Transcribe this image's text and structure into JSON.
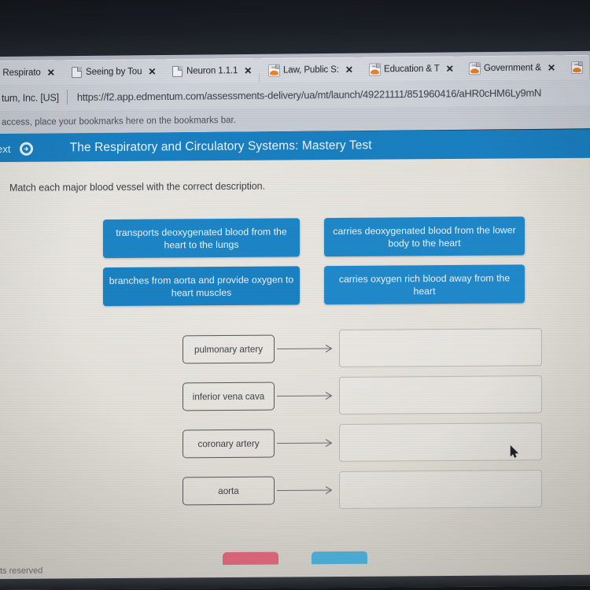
{
  "browser": {
    "tabs": [
      {
        "title": "e Respirato",
        "favicon": "page-icon",
        "partial": true
      },
      {
        "title": "Seeing by Tou",
        "favicon": "page-icon",
        "partial": false
      },
      {
        "title": "Neuron 1.1.1",
        "favicon": "page-icon",
        "partial": false
      },
      {
        "title": "Law, Public S:",
        "favicon": "edmentum-icon",
        "partial": false
      },
      {
        "title": "Education & T",
        "favicon": "edmentum-icon",
        "partial": false
      },
      {
        "title": "Government &",
        "favicon": "edmentum-icon",
        "partial": false
      },
      {
        "title": "",
        "favicon": "edmentum-icon",
        "partial": false
      }
    ],
    "tab_close_label": "✕",
    "site_identity": "tum, Inc. [US]",
    "url": "https://f2.app.edmentum.com/assessments-delivery/ua/mt/launch/49221111/851960416/aHR0cHM6Ly9mN",
    "bookmarks_hint": "access, place your bookmarks here on the bookmarks bar."
  },
  "app_header": {
    "next_label": "ext",
    "next_icon": "arrow-right-circle-icon",
    "test_title": "The Respiratory and Circulatory Systems: Mastery Test",
    "background_color": "#1a7fc0"
  },
  "question": {
    "prompt": "Match each major blood vessel with the correct description.",
    "tiles": [
      "transports deoxygenated blood from the heart to the lungs",
      "carries deoxygenated blood from the lower body to the heart",
      "branches from aorta and provide oxygen to heart muscles",
      "carries oxygen rich blood away from the heart"
    ],
    "tile_color": "#1d85c6",
    "matches": [
      {
        "term": "pulmonary artery",
        "answer": ""
      },
      {
        "term": "inferior vena cava",
        "answer": ""
      },
      {
        "term": "coronary artery",
        "answer": ""
      },
      {
        "term": "aorta",
        "answer": ""
      }
    ],
    "arrow_icon": "arrow-right-icon"
  },
  "footer": {
    "buttons": [
      {
        "name": "reset",
        "color": "#e3697d"
      },
      {
        "name": "submit",
        "color": "#4fb3dd"
      }
    ],
    "copyright_text": "ts reserved"
  },
  "pointer": {
    "icon": "mouse-cursor-icon"
  }
}
